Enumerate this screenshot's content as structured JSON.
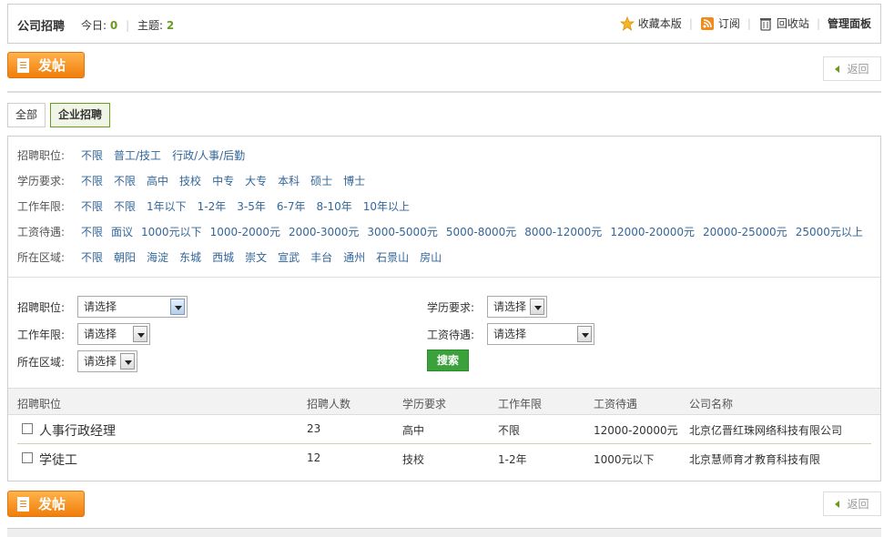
{
  "header": {
    "title": "公司招聘",
    "today_label": "今日:",
    "today_count": "0",
    "topics_label": "主题:",
    "topics_count": "2",
    "tools": {
      "favorite": "收藏本版",
      "subscribe": "订阅",
      "recycle": "回收站",
      "manage": "管理面板"
    }
  },
  "actions": {
    "post_label": "发帖",
    "back_label": "返回"
  },
  "tabs": [
    "全部",
    "企业招聘"
  ],
  "filters": [
    {
      "label": "招聘职位:",
      "options": [
        "不限",
        "普工/技工",
        "行政/人事/后勤"
      ]
    },
    {
      "label": "学历要求:",
      "options": [
        "不限",
        "不限",
        "高中",
        "技校",
        "中专",
        "大专",
        "本科",
        "硕士",
        "博士"
      ]
    },
    {
      "label": "工作年限:",
      "options": [
        "不限",
        "不限",
        "1年以下",
        "1-2年",
        "3-5年",
        "6-7年",
        "8-10年",
        "10年以上"
      ]
    },
    {
      "label": "工资待遇:",
      "options": [
        "不限",
        "面议",
        "1000元以下",
        "1000-2000元",
        "2000-3000元",
        "3000-5000元",
        "5000-8000元",
        "8000-12000元",
        "12000-20000元",
        "20000-25000元",
        "25000元以上"
      ]
    },
    {
      "label": "所在区域:",
      "options": [
        "不限",
        "朝阳",
        "海淀",
        "东城",
        "西城",
        "崇文",
        "宣武",
        "丰台",
        "通州",
        "石景山",
        "房山"
      ]
    }
  ],
  "search_form": {
    "position_label": "招聘职位:",
    "education_label": "学历要求:",
    "experience_label": "工作年限:",
    "salary_label": "工资待遇:",
    "area_label": "所在区域:",
    "select_value": "请选择",
    "search_label": "搜索"
  },
  "table": {
    "headers": [
      "招聘职位",
      "招聘人数",
      "学历要求",
      "工作年限",
      "工资待遇",
      "公司名称"
    ],
    "rows": [
      {
        "title": "人事行政经理",
        "count": "23",
        "education": "高中",
        "experience": "不限",
        "salary": "12000-20000元",
        "company": "北京亿晋红珠网络科技有限公司"
      },
      {
        "title": "学徒工",
        "count": "12",
        "education": "技校",
        "experience": "1-2年",
        "salary": "1000元以下",
        "company": "北京慧师育才教育科技有限"
      }
    ]
  },
  "colors": {
    "accent_green": "#6a9a1f",
    "link_blue": "#336699",
    "post_orange": "#f07e0c",
    "search_green": "#3ba23b"
  }
}
